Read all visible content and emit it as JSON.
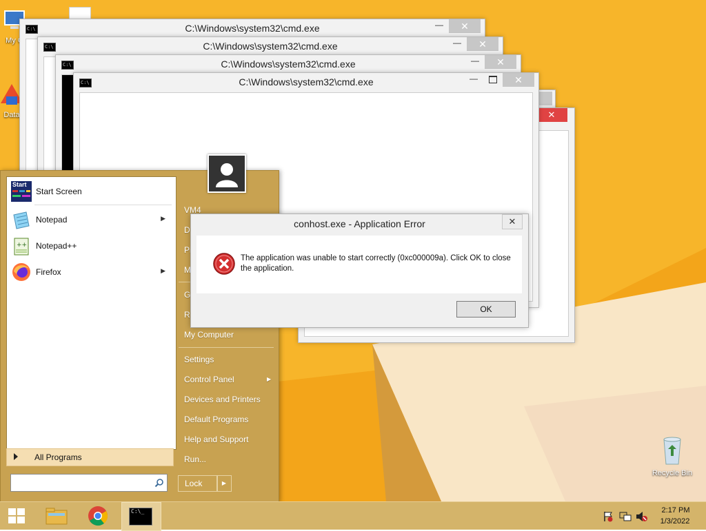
{
  "desktop": {
    "icons": [
      {
        "label": "My C"
      },
      {
        "label": "Data"
      },
      {
        "label": "Recycle Bin"
      }
    ]
  },
  "cmd_windows": [
    {
      "title": "C:\\Windows\\system32\\cmd.exe"
    },
    {
      "title": "C:\\Windows\\system32\\cmd.exe"
    },
    {
      "title": "C:\\Windows\\system32\\cmd.exe"
    },
    {
      "title": "C:\\Windows\\system32\\cmd.exe"
    }
  ],
  "start_menu": {
    "pinned": [
      {
        "label": "Start Screen",
        "icon": "start-screen-icon",
        "icon_text": "Start"
      },
      {
        "label": "Notepad",
        "icon": "notepad-icon",
        "has_submenu": true
      },
      {
        "label": "Notepad++",
        "icon": "notepad-plus-plus-icon"
      },
      {
        "label": "Firefox",
        "icon": "firefox-icon",
        "has_submenu": true
      }
    ],
    "all_programs": "All Programs",
    "search_placeholder": "",
    "right_items": [
      {
        "label": "VM4"
      },
      {
        "label": "D"
      },
      {
        "label": "Pi"
      },
      {
        "label": "M"
      },
      {
        "label": "Ga"
      },
      {
        "label": "Re"
      },
      {
        "label": "My Computer"
      },
      {
        "label": "Settings"
      },
      {
        "label": "Control Panel",
        "has_submenu": true
      },
      {
        "label": "Devices and Printers"
      },
      {
        "label": "Default Programs"
      },
      {
        "label": "Help and Support"
      },
      {
        "label": "Run..."
      }
    ],
    "lock_label": "Lock"
  },
  "error_dialog": {
    "title": "conhost.exe - Application Error",
    "message": "The application was unable to start correctly (0xc000009a). Click OK to close the application.",
    "ok_label": "OK",
    "close_glyph": "✕"
  },
  "taskbar": {
    "time": "2:17 PM",
    "date": "1/3/2022"
  },
  "colors": {
    "wallpaper": "#f3a51a",
    "start_menu": "#c8a251",
    "taskbar": "#d4b46a",
    "error_red": "#d32f2f"
  }
}
